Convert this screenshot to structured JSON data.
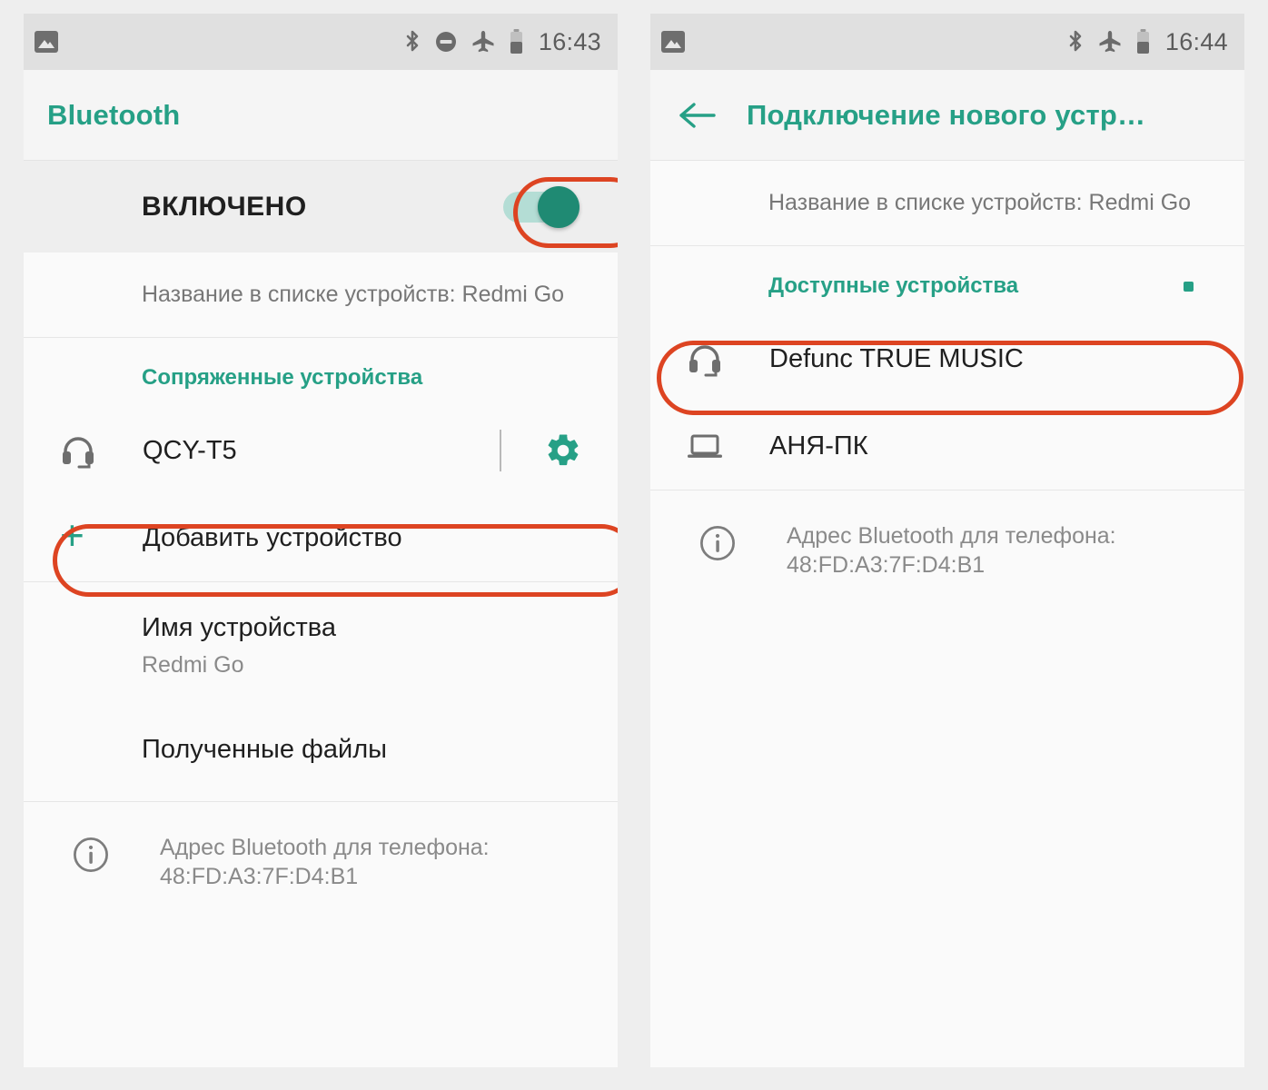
{
  "left_screen": {
    "status_bar": {
      "gallery_icon": "gallery-icon",
      "bluetooth_icon": "bluetooth-icon",
      "dnd_icon": "do-not-disturb-icon",
      "airplane_icon": "airplane-mode-icon",
      "battery_icon": "battery-icon",
      "time": "16:43"
    },
    "appbar": {
      "title": "Bluetooth"
    },
    "toggle": {
      "label": "ВКЛЮЧЕНО",
      "state": "on"
    },
    "device_name_notice": "Название в списке устройств: Redmi Go",
    "paired_section": {
      "header": "Сопряженные устройства"
    },
    "paired_devices": [
      {
        "name": "QCY-T5",
        "icon": "headset-icon",
        "settings_icon": "gear-icon"
      }
    ],
    "add_device": {
      "label": "Добавить устройство",
      "icon": "plus-icon"
    },
    "device_name_item": {
      "title": "Имя устройства",
      "value": "Redmi Go"
    },
    "received_files": {
      "label": "Полученные файлы"
    },
    "bluetooth_address": {
      "icon": "info-icon",
      "label": "Адрес Bluetooth для телефона:",
      "value": "48:FD:A3:7F:D4:B1"
    }
  },
  "right_screen": {
    "status_bar": {
      "gallery_icon": "gallery-icon",
      "bluetooth_icon": "bluetooth-icon",
      "airplane_icon": "airplane-mode-icon",
      "battery_icon": "battery-icon",
      "time": "16:44"
    },
    "appbar": {
      "back_icon": "arrow-left-icon",
      "title": "Подключение нового устр…"
    },
    "device_name_notice": "Название в списке устройств: Redmi Go",
    "available_section": {
      "header": "Доступные устройства",
      "scan_indicator": "scanning-dot"
    },
    "available_devices": [
      {
        "name": "Defunc TRUE MUSIC",
        "icon": "headset-icon"
      },
      {
        "name": "АНЯ-ПК",
        "icon": "laptop-icon"
      }
    ],
    "bluetooth_address": {
      "icon": "info-icon",
      "label": "Адрес Bluetooth для телефона:",
      "value": "48:FD:A3:7F:D4:B1"
    }
  },
  "colors": {
    "accent_teal": "#26a086",
    "toggle_thumb": "#1f8a73",
    "toggle_track": "#b4ddd5",
    "annotation_red": "#dd4422",
    "page_background": "#eeeeee",
    "card_background": "#fafafa",
    "status_bar_background": "#e0e0e0"
  },
  "annotations": [
    {
      "name": "highlight-bluetooth-toggle",
      "shape": "oval",
      "color": "#dd4422"
    },
    {
      "name": "highlight-add-device",
      "shape": "oval",
      "color": "#dd4422"
    },
    {
      "name": "highlight-defunc-device",
      "shape": "oval",
      "color": "#dd4422"
    }
  ]
}
